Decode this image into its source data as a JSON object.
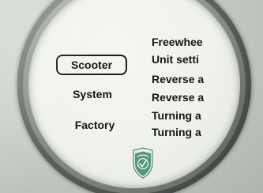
{
  "menu": {
    "items": [
      {
        "label": "Scooter",
        "selected": true
      },
      {
        "label": "System",
        "selected": false
      },
      {
        "label": "Factory",
        "selected": false
      }
    ]
  },
  "options": {
    "items": [
      {
        "label": "Freewhee"
      },
      {
        "label": "Unit setti"
      },
      {
        "label": "Reverse a"
      },
      {
        "label": "Reverse a"
      },
      {
        "label": "Turning a"
      },
      {
        "label": "Turning a"
      }
    ]
  },
  "logo": {
    "icon": "shield-logo-icon",
    "colors": {
      "shield": "#4e9a7e",
      "ring": "#e8eee6",
      "mark": "#f2f6f0"
    }
  }
}
